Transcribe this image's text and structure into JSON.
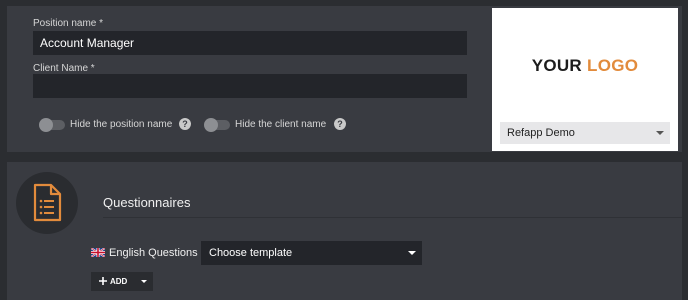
{
  "position_form": {
    "position_name_label": "Position name *",
    "position_name_value": "Account Manager",
    "client_name_label": "Client Name *",
    "client_name_value": "",
    "hide_position_label": "Hide the position name",
    "hide_client_label": "Hide the client name",
    "help_glyph": "?"
  },
  "logo": {
    "word1": "YOUR",
    "word2": "LOGO",
    "company_select_value": "Refapp Demo"
  },
  "questionnaires": {
    "title": "Questionnaires",
    "language_label": "English Questions",
    "template_select_value": "Choose template",
    "add_label": "ADD"
  },
  "colors": {
    "accent": "#e28b3c",
    "panel": "#393b41",
    "input": "#23252a"
  }
}
